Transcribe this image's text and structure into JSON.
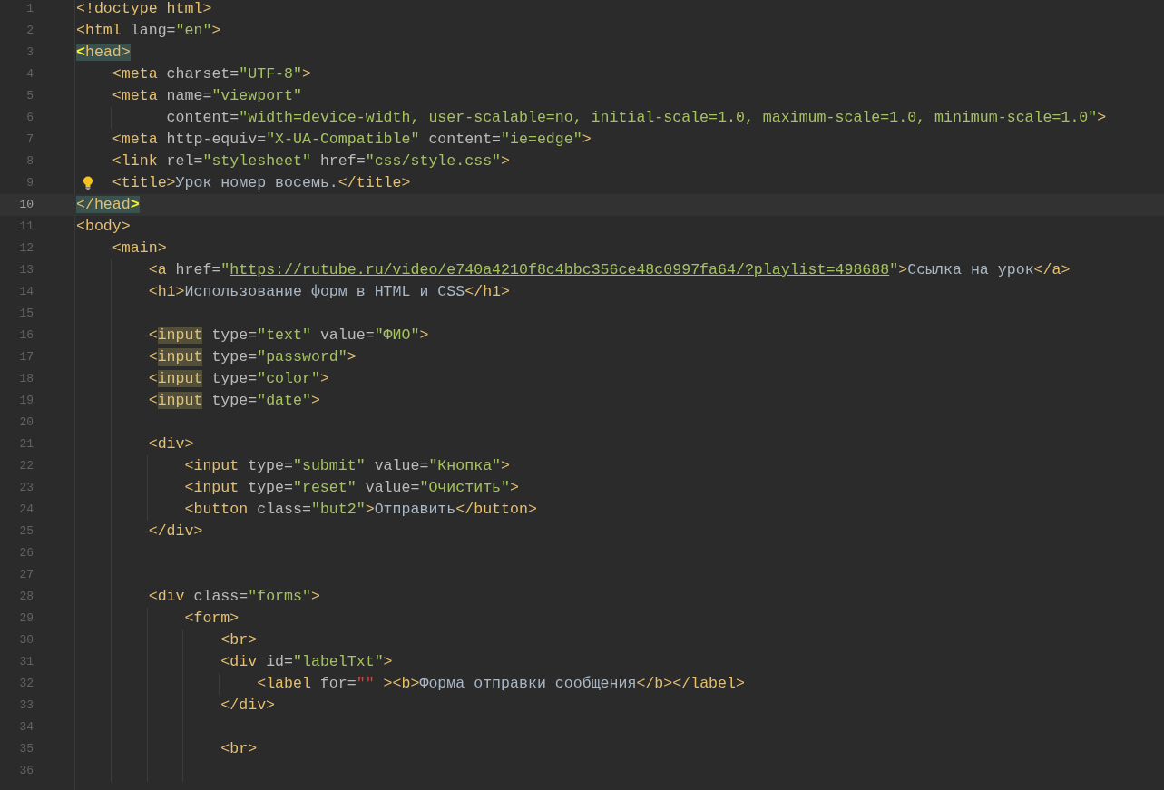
{
  "editor": {
    "lines": [
      {
        "number": "1",
        "tokens": [
          {
            "kind": "tag",
            "t": "<!doctype html>"
          }
        ]
      },
      {
        "number": "2",
        "tokens": [
          {
            "kind": "tag",
            "t": "<html"
          },
          {
            "kind": "attr",
            "t": " lang="
          },
          {
            "kind": "str",
            "t": "\"en\""
          },
          {
            "kind": "tag",
            "t": ">"
          }
        ]
      },
      {
        "number": "3",
        "tokens": [
          {
            "kind": "brace",
            "t": "<",
            "brace_match": true
          },
          {
            "kind": "tag",
            "t": "head>",
            "brace_match": true
          }
        ]
      },
      {
        "number": "4",
        "tokens": [
          {
            "kind": "tag",
            "t": "    <meta"
          },
          {
            "kind": "attr",
            "t": " charset="
          },
          {
            "kind": "str",
            "t": "\"UTF-8\""
          },
          {
            "kind": "tag",
            "t": ">"
          }
        ]
      },
      {
        "number": "5",
        "tokens": [
          {
            "kind": "tag",
            "t": "    <meta"
          },
          {
            "kind": "attr",
            "t": " name="
          },
          {
            "kind": "str",
            "t": "\"viewport\""
          }
        ]
      },
      {
        "number": "6",
        "tokens": [
          {
            "kind": "attr",
            "t": "          content="
          },
          {
            "kind": "str",
            "t": "\"width=device-width, user-scalable=no, initial-scale=1.0, maximum-scale=1.0, minimum-scale=1.0\""
          },
          {
            "kind": "tag",
            "t": ">"
          }
        ]
      },
      {
        "number": "7",
        "tokens": [
          {
            "kind": "tag",
            "t": "    <meta"
          },
          {
            "kind": "attr",
            "t": " http-equiv="
          },
          {
            "kind": "str",
            "t": "\"X-UA-Compatible\""
          },
          {
            "kind": "attr",
            "t": " content="
          },
          {
            "kind": "str",
            "t": "\"ie=edge\""
          },
          {
            "kind": "tag",
            "t": ">"
          }
        ]
      },
      {
        "number": "8",
        "tokens": [
          {
            "kind": "tag",
            "t": "    <link"
          },
          {
            "kind": "attr",
            "t": " rel="
          },
          {
            "kind": "str",
            "t": "\"stylesheet\""
          },
          {
            "kind": "attr",
            "t": " href="
          },
          {
            "kind": "str",
            "t": "\"css/style.css\""
          },
          {
            "kind": "tag",
            "t": ">"
          }
        ]
      },
      {
        "number": "9",
        "bulb": true,
        "tokens": [
          {
            "kind": "tag",
            "t": "    <title>"
          },
          {
            "kind": "text",
            "t": "Урок номер восемь."
          },
          {
            "kind": "tag",
            "t": "</title>"
          }
        ]
      },
      {
        "number": "10",
        "current": true,
        "tokens": [
          {
            "kind": "tag",
            "t": "</head",
            "brace_match": true
          },
          {
            "kind": "brace",
            "t": ">",
            "brace_match": true
          }
        ]
      },
      {
        "number": "11",
        "tokens": [
          {
            "kind": "tag",
            "t": "<body>"
          }
        ]
      },
      {
        "number": "12",
        "tokens": [
          {
            "kind": "tag",
            "t": "    <main>"
          }
        ]
      },
      {
        "number": "13",
        "tokens": [
          {
            "kind": "tag",
            "t": "        <a"
          },
          {
            "kind": "attr",
            "t": " href="
          },
          {
            "kind": "str",
            "t": "\""
          },
          {
            "kind": "url",
            "t": "https://rutube.ru/video/e740a4210f8c4bbc356ce48c0997fa64/?playlist=498688"
          },
          {
            "kind": "str",
            "t": "\""
          },
          {
            "kind": "tag",
            "t": ">"
          },
          {
            "kind": "text",
            "t": "Ссылка на урок"
          },
          {
            "kind": "tag",
            "t": "</a>"
          }
        ]
      },
      {
        "number": "14",
        "tokens": [
          {
            "kind": "tag",
            "t": "        <h1>"
          },
          {
            "kind": "text",
            "t": "Использование форм в HTML и CSS"
          },
          {
            "kind": "tag",
            "t": "</h1>"
          }
        ]
      },
      {
        "number": "15"
      },
      {
        "number": "16",
        "tokens": [
          {
            "kind": "tag",
            "t": "        <"
          },
          {
            "kind": "tag",
            "t": "input",
            "usage_highlight": true
          },
          {
            "kind": "attr",
            "t": " type="
          },
          {
            "kind": "str",
            "t": "\"text\""
          },
          {
            "kind": "attr",
            "t": " value="
          },
          {
            "kind": "str",
            "t": "\"ФИО\""
          },
          {
            "kind": "tag",
            "t": ">"
          }
        ]
      },
      {
        "number": "17",
        "tokens": [
          {
            "kind": "tag",
            "t": "        <"
          },
          {
            "kind": "tag",
            "t": "input",
            "usage_highlight": true
          },
          {
            "kind": "attr",
            "t": " type="
          },
          {
            "kind": "str",
            "t": "\"password\""
          },
          {
            "kind": "tag",
            "t": ">"
          }
        ]
      },
      {
        "number": "18",
        "tokens": [
          {
            "kind": "tag",
            "t": "        <"
          },
          {
            "kind": "tag",
            "t": "input",
            "usage_highlight": true
          },
          {
            "kind": "attr",
            "t": " type="
          },
          {
            "kind": "str",
            "t": "\"color\""
          },
          {
            "kind": "tag",
            "t": ">"
          }
        ]
      },
      {
        "number": "19",
        "tokens": [
          {
            "kind": "tag",
            "t": "        <"
          },
          {
            "kind": "tag",
            "t": "input",
            "usage_highlight": true
          },
          {
            "kind": "attr",
            "t": " type="
          },
          {
            "kind": "str",
            "t": "\"date\""
          },
          {
            "kind": "tag",
            "t": ">"
          }
        ]
      },
      {
        "number": "20"
      },
      {
        "number": "21",
        "tokens": [
          {
            "kind": "tag",
            "t": "        <div>"
          }
        ]
      },
      {
        "number": "22",
        "tokens": [
          {
            "kind": "tag",
            "t": "            <input"
          },
          {
            "kind": "attr",
            "t": " type="
          },
          {
            "kind": "str",
            "t": "\"submit\""
          },
          {
            "kind": "attr",
            "t": " value="
          },
          {
            "kind": "str",
            "t": "\"Кнопка\""
          },
          {
            "kind": "tag",
            "t": ">"
          }
        ]
      },
      {
        "number": "23",
        "tokens": [
          {
            "kind": "tag",
            "t": "            <input"
          },
          {
            "kind": "attr",
            "t": " type="
          },
          {
            "kind": "str",
            "t": "\"reset\""
          },
          {
            "kind": "attr",
            "t": " value="
          },
          {
            "kind": "str",
            "t": "\"Очистить\""
          },
          {
            "kind": "tag",
            "t": ">"
          }
        ]
      },
      {
        "number": "24",
        "tokens": [
          {
            "kind": "tag",
            "t": "            <button"
          },
          {
            "kind": "attr",
            "t": " class="
          },
          {
            "kind": "str",
            "t": "\"but2\""
          },
          {
            "kind": "tag",
            "t": ">"
          },
          {
            "kind": "text",
            "t": "Отправить"
          },
          {
            "kind": "tag",
            "t": "</button>"
          }
        ]
      },
      {
        "number": "25",
        "tokens": [
          {
            "kind": "tag",
            "t": "        </div>"
          }
        ]
      },
      {
        "number": "26"
      },
      {
        "number": "27"
      },
      {
        "number": "28",
        "tokens": [
          {
            "kind": "tag",
            "t": "        <div"
          },
          {
            "kind": "attr",
            "t": " class="
          },
          {
            "kind": "str",
            "t": "\"forms\""
          },
          {
            "kind": "tag",
            "t": ">"
          }
        ]
      },
      {
        "number": "29",
        "tokens": [
          {
            "kind": "tag",
            "t": "            <form>"
          }
        ]
      },
      {
        "number": "30",
        "tokens": [
          {
            "kind": "tag",
            "t": "                <br>"
          }
        ]
      },
      {
        "number": "31",
        "tokens": [
          {
            "kind": "tag",
            "t": "                <div"
          },
          {
            "kind": "attr",
            "t": " id="
          },
          {
            "kind": "str",
            "t": "\"labelTxt\""
          },
          {
            "kind": "tag",
            "t": ">"
          }
        ]
      },
      {
        "number": "32",
        "tokens": [
          {
            "kind": "tag",
            "t": "                    <label"
          },
          {
            "kind": "attr",
            "t": " for="
          },
          {
            "kind": "err",
            "t": "\"\""
          },
          {
            "kind": "tag",
            "t": " ><b>"
          },
          {
            "kind": "text",
            "t": "Форма отправки сообщения"
          },
          {
            "kind": "tag",
            "t": "</b></label>"
          }
        ]
      },
      {
        "number": "33",
        "tokens": [
          {
            "kind": "tag",
            "t": "                </div>"
          }
        ]
      },
      {
        "number": "34"
      },
      {
        "number": "35",
        "tokens": [
          {
            "kind": "tag",
            "t": "                <br>"
          }
        ]
      },
      {
        "number": "36"
      }
    ]
  }
}
